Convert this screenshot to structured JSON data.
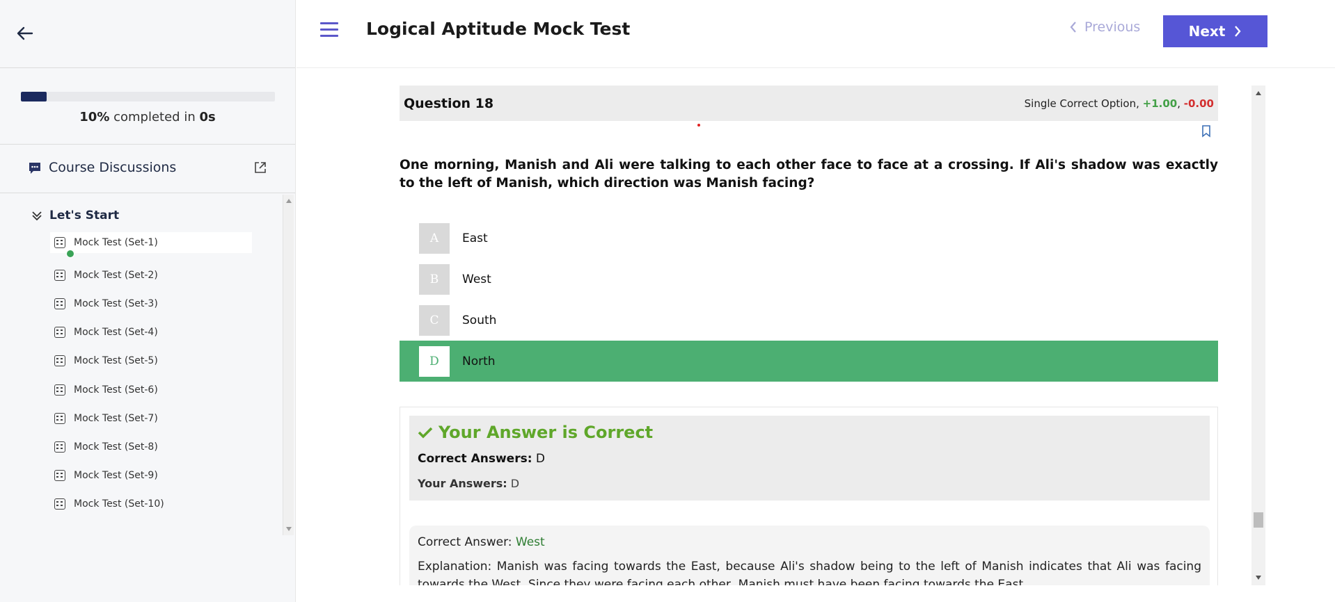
{
  "sidebar": {
    "back_icon": "arrow-left-icon",
    "progress": {
      "percent_value": 0.1,
      "percent": "10%",
      "mid_text": " completed in ",
      "time": "0s"
    },
    "discussions": {
      "label": "Course Discussions",
      "icon": "chat-icon",
      "action_icon": "external-link-icon"
    },
    "section": {
      "label": "Let's Start",
      "icon": "double-chevron-down-icon",
      "items": [
        {
          "label": "Mock Test (Set-1)",
          "completed": true
        },
        {
          "label": "Mock Test (Set-2)",
          "completed": false
        },
        {
          "label": "Mock Test (Set-3)",
          "completed": false
        },
        {
          "label": "Mock Test (Set-4)",
          "completed": false
        },
        {
          "label": "Mock Test (Set-5)",
          "completed": false
        },
        {
          "label": "Mock Test (Set-6)",
          "completed": false
        },
        {
          "label": "Mock Test (Set-7)",
          "completed": false
        },
        {
          "label": "Mock Test (Set-8)",
          "completed": false
        },
        {
          "label": "Mock Test (Set-9)",
          "completed": false
        },
        {
          "label": "Mock Test (Set-10)",
          "completed": false
        }
      ]
    }
  },
  "header": {
    "title": "Logical Aptitude Mock Test",
    "prev_label": "Previous",
    "next_label": "Next"
  },
  "question": {
    "number_label": "Question 18",
    "type_label": "Single Correct Option, ",
    "positive": "+1.00",
    "separator": ", ",
    "negative": "-0.00",
    "text": "One morning, Manish and Ali were talking to each other face to face at a crossing. If Ali's shadow was exactly to the left of Manish, which direction was Manish facing?",
    "options": [
      {
        "letter": "A",
        "text": "East",
        "selected": false
      },
      {
        "letter": "B",
        "text": "West",
        "selected": false
      },
      {
        "letter": "C",
        "text": "South",
        "selected": false
      },
      {
        "letter": "D",
        "text": "North",
        "selected": true
      }
    ]
  },
  "result": {
    "title": "Your Answer is Correct",
    "correct_label": "Correct Answers:",
    "correct_value": "D",
    "your_label": "Your Answers:",
    "your_value": "D"
  },
  "explanation": {
    "correct_label": "Correct Answer: ",
    "correct_value": "West",
    "text": "Explanation: Manish was facing towards the East, because Ali's shadow being to the left of Manish indicates that Ali was facing towards the West. Since they were facing each other, Manish must have been facing towards the East."
  },
  "colors": {
    "accent": "#5656d6",
    "correct": "#4caf72",
    "progress": "#1b2a5e"
  }
}
